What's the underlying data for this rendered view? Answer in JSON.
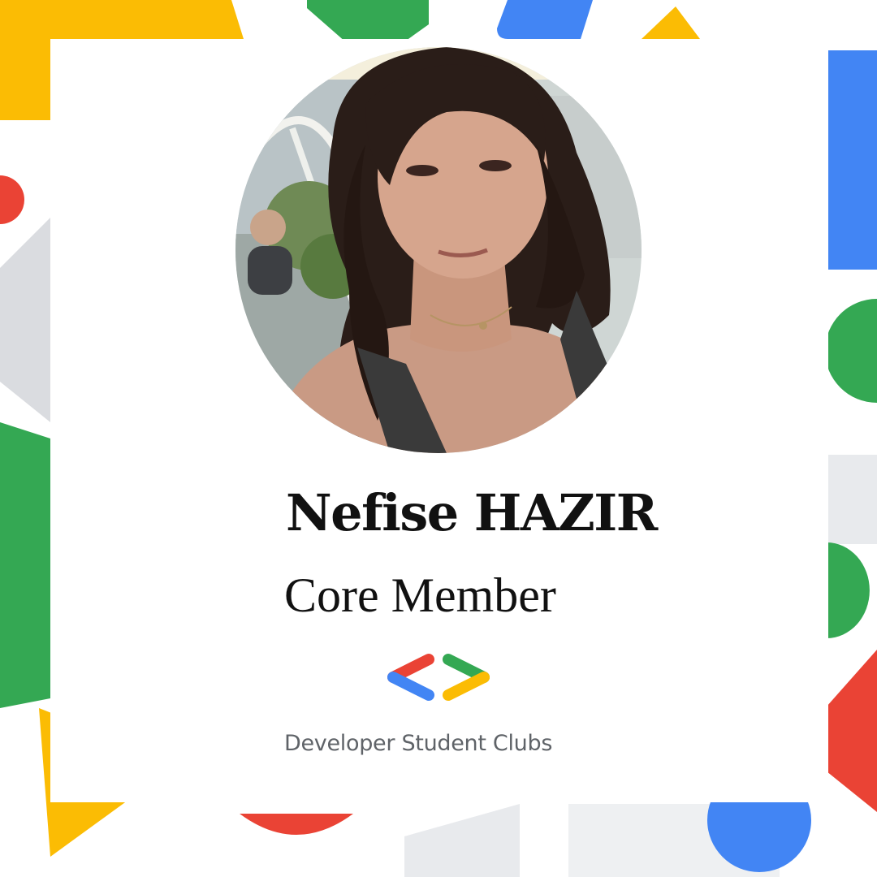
{
  "profile": {
    "name": "Nefise HAZIR",
    "role": "Core Member"
  },
  "organization": {
    "name": "Developer Student Clubs",
    "logo_icon": "developer-student-clubs-logo-icon"
  },
  "colors": {
    "google_blue": "#4285F4",
    "google_red": "#EA4335",
    "google_yellow": "#FBBC04",
    "google_green": "#34A853",
    "shape_grey": "#DADCE0",
    "text_dark": "#111111",
    "text_grey": "#5F6368"
  }
}
